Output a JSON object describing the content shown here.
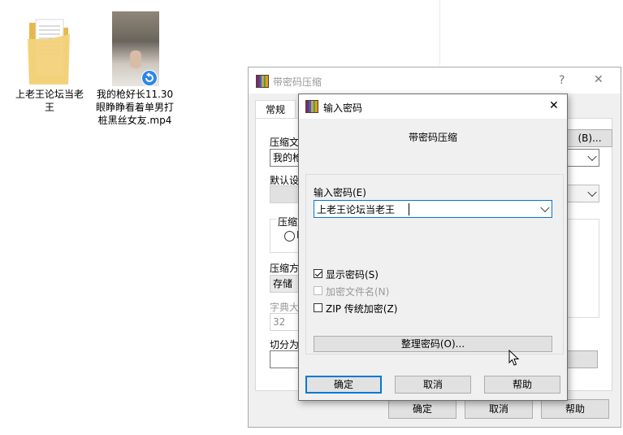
{
  "desktop": {
    "folder_label": "上老王论坛当老王",
    "video_label": "我的枪好长11.30 眼睁睁看着单男打桩黑丝女友.mp4"
  },
  "parent_dialog": {
    "title": "带密码压缩",
    "help_glyph": "?",
    "close_glyph": "✕",
    "tab_general": "常规",
    "archive_name_label_partial": "压缩文",
    "archive_name_value_partial": "我的枪",
    "browse_button": "(B)...",
    "default_profile_label_partial": "默认设",
    "format_group_label_partial": "压缩文",
    "format_radio_partial": "R",
    "method_label_partial": "压缩方",
    "method_value_partial": "存储",
    "dict_label_partial": "字典大",
    "dict_value_partial": "32",
    "split_label_partial": "切分为",
    "ok_button": "确定",
    "cancel_button": "取消",
    "help_button": "帮助"
  },
  "password_dialog": {
    "title": "输入密码",
    "close_glyph": "✕",
    "header_text": "带密码压缩",
    "password_label": "输入密码(E)",
    "password_value": "上老王论坛当老王",
    "show_password_label": "显示密码(S)",
    "show_password_checked": true,
    "encrypt_filenames_label": "加密文件名(N)",
    "encrypt_filenames_checked": false,
    "zip_legacy_label": "ZIP 传统加密(Z)",
    "zip_legacy_checked": false,
    "organize_button": "整理密码(O)...",
    "ok_button": "确定",
    "cancel_button": "取消",
    "help_button": "帮助"
  },
  "colors": {
    "folder_yellow": "#f3d27a",
    "dialog_face": "#f0f0f0",
    "accent_blue": "#0078d7"
  }
}
